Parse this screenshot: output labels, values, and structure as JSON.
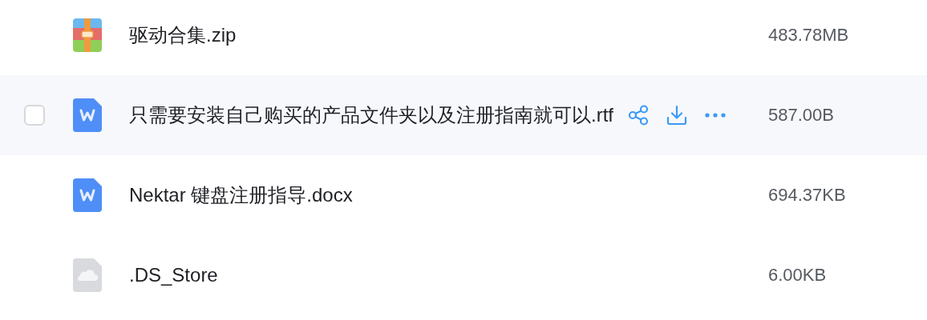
{
  "files": [
    {
      "kind": "zip",
      "name": "驱动合集.zip",
      "size": "483.78MB",
      "hovered": false,
      "checked": false
    },
    {
      "kind": "word",
      "name": "只需要安装自己购买的产品文件夹以及注册指南就可以.rtf",
      "size": "587.00B",
      "hovered": true,
      "checked": false
    },
    {
      "kind": "word",
      "name": "Nektar 键盘注册指导.docx",
      "size": "694.37KB",
      "hovered": false,
      "checked": false
    },
    {
      "kind": "unknown",
      "name": ".DS_Store",
      "size": "6.00KB",
      "hovered": false,
      "checked": false
    }
  ]
}
